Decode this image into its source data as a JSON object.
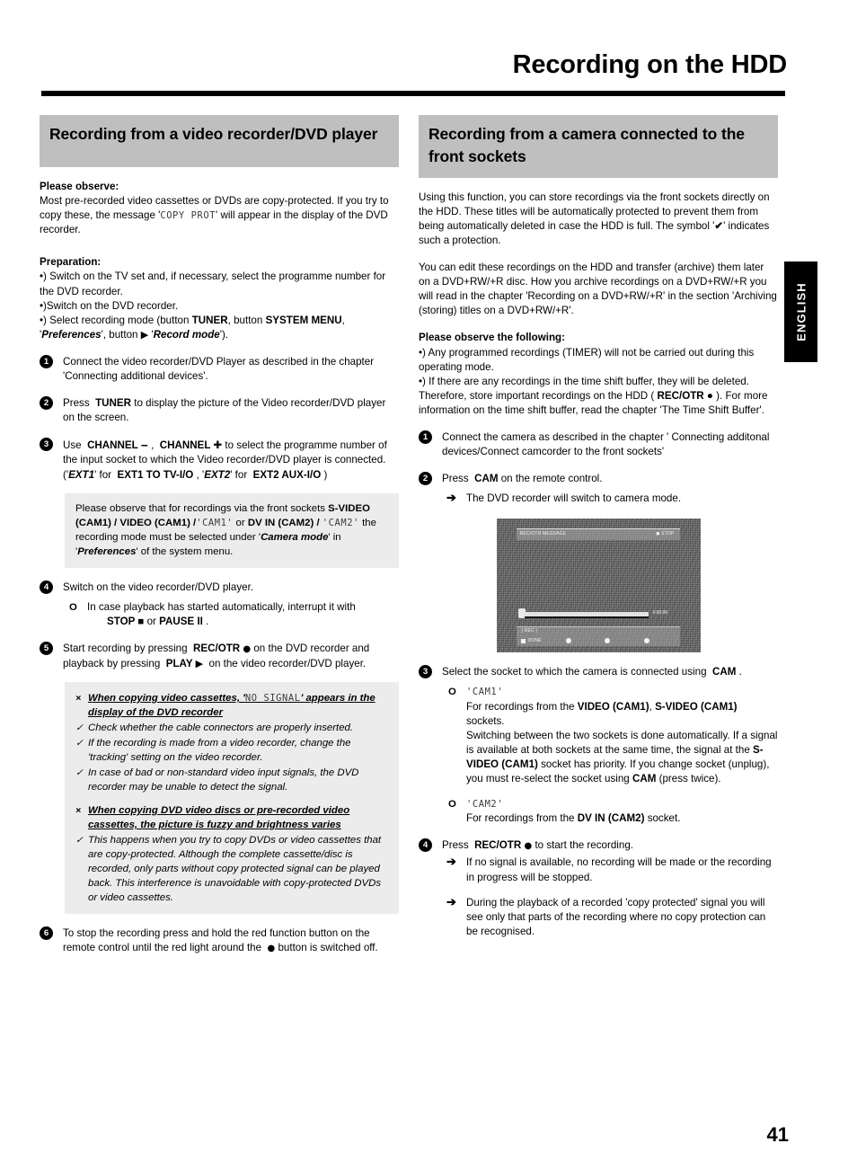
{
  "header": {
    "title": "Recording on the HDD"
  },
  "lang_tab": {
    "label": "ENGLISH"
  },
  "page_number": "41",
  "left_column": {
    "section_heading": "Recording from a video recorder/DVD player",
    "observe_heading": "Please observe:",
    "observe_text_1": "Most pre-recorded video cassettes or DVDs are copy-protected. If you try to copy these, the message '",
    "observe_lcd": "COPY PROT",
    "observe_text_2": "' will appear in the display of the DVD recorder.",
    "preparation_heading": "Preparation:",
    "prep_1": "•) Switch on the TV set and, if necessary, select the programme number for the DVD recorder.",
    "prep_2": "•)Switch on the DVD recorder.",
    "prep_3_a": "•) Select recording mode (button",
    "prep_3_b": "TUNER",
    "prep_3_c": ", button",
    "prep_3_d": "SYSTEM MENU",
    "prep_3_e": ", '",
    "prep_3_f": "Preferences",
    "prep_3_g": "', button",
    "prep_3_h": "'",
    "prep_3_i": "Record mode",
    "prep_3_j": "').",
    "steps": [
      {
        "num": "1",
        "text": "Connect the video recorder/DVD Player as described in the chapter 'Connecting additional devices'."
      },
      {
        "num": "2",
        "text": "Press  TUNER  to display the picture of the Video recorder/DVD player on the screen."
      },
      {
        "num": "3",
        "text": "Use  CHANNEL −  ,  CHANNEL +  to select the programme number of the input socket to which the Video recorder/DVD player is connected. ('EXT1' for  EXT1 TO TV-I/O , 'EXT2' for  EXT2 AUX-I/O )"
      },
      {
        "num": "4",
        "text": "Switch on the video recorder/DVD player."
      },
      {
        "num": "5",
        "text": "Start recording by pressing  REC/OTR ●  on the DVD recorder and playback by pressing  PLAY ▶  on the video recorder/DVD player."
      },
      {
        "num": "6",
        "text": "To stop the recording press and hold the red function button on the remote control until the red light around the ● button is switched off."
      }
    ],
    "step3_note": {
      "t1": "Please observe that for recordings via the front sockets",
      "b1": "S-VIDEO (CAM1)",
      "s1": "/",
      "b2": "VIDEO (CAM1)",
      "s2": "/",
      "lcd1": "CAM1",
      "t2": "or",
      "b3": "DV IN (CAM2)",
      "s3": "/",
      "lcd2": "CAM2",
      "t3": "the recording mode must be selected under '",
      "bi1": "Camera mode",
      "t4": "' in '",
      "bi2": "Preferences",
      "t5": "' of the system menu."
    },
    "step4_sub": {
      "t1": "In case playback has started automatically, interrupt it with",
      "b1": "STOP ■",
      "t2": "or",
      "b2": "PAUSE II",
      "t3": "."
    },
    "trouble_1": {
      "problem_a": "When copying video cassettes, '",
      "problem_lcd": "NO SIGNAL",
      "problem_b": "' appears in the display of the DVD recorder",
      "solutions": [
        "Check whether the cable connectors are properly inserted.",
        "If the recording is made from a video recorder, change the 'tracking' setting on the video recorder.",
        "In case of bad or non-standard video input signals, the DVD recorder may be unable to detect the signal."
      ]
    },
    "trouble_2": {
      "problem": "When copying DVD video discs or pre-recorded video cassettes, the picture is fuzzy and brightness varies",
      "solutions": [
        "This happens when you try to copy DVDs or video cassettes that are copy-protected. Although the complete cassette/disc is recorded, only parts without copy protected signal can be played back. This interference is unavoidable with copy-protected DVDs or video cassettes."
      ]
    }
  },
  "right_column": {
    "section_heading": "Recording from a camera connected to the front sockets",
    "intro_1_a": "Using this function, you can store recordings via the front sockets directly on the HDD. These titles will be automatically protected to prevent them from being automatically deleted in case the HDD is full. The symbol '",
    "intro_1_check": "✔",
    "intro_1_b": "' indicates such a protection.",
    "intro_2": "You can edit these recordings on the HDD and transfer (archive) them later on a DVD+RW/+R disc. How you archive recordings on a DVD+RW/+R you will read in the chapter 'Recording on a DVD+RW/+R' in the section 'Archiving (storing) titles on a DVD+RW/+R'.",
    "observe_heading": "Please observe the following:",
    "observe_1": "•) Any programmed recordings (TIMER) will not be carried out during this operating mode.",
    "observe_2_a": "•) If there are any recordings in the time shift buffer, they will be deleted. Therefore, store important recordings on the HDD (",
    "observe_2_b": "REC/OTR ●",
    "observe_2_c": "). For more information on the time shift buffer, read the chapter 'The Time Shift Buffer'.",
    "steps": [
      {
        "num": "1",
        "text": "Connect the camera as described in the chapter ' Connecting additonal devices/Connect camcorder to the front sockets'"
      },
      {
        "num": "2",
        "text": "Press  CAM  on the remote control."
      },
      {
        "num": "3",
        "text": "Select the socket to which the camera is connected using  CAM ."
      },
      {
        "num": "4",
        "text": "Press  REC/OTR ●  to start the recording."
      }
    ],
    "step2_sub": "The DVD recorder will switch to camera mode.",
    "screenshot": {
      "osd_top_left": "REC/OTR MESSAGE",
      "osd_top_right": "◼ STOP",
      "osd_time": "0:00:00",
      "osd_rec_label": "[ REC ]",
      "osd_done_label": "DONE"
    },
    "cam1_block": {
      "lcd": "CAM1",
      "l1_a": "For recordings from the",
      "l1_b": "VIDEO (CAM1)",
      "l1_c": ",",
      "l1_d": "S-VIDEO (CAM1)",
      "l1_e": "sockets.",
      "l2_a": "Switching between the two sockets is done automatically. If a signal is available at both sockets at the same time, the signal at the",
      "l2_b": "S-VIDEO (CAM1)",
      "l2_c": "socket has priority. If you change socket (unplug), you must re-select the socket using",
      "l2_d": "CAM",
      "l2_e": "(press twice)."
    },
    "cam2_block": {
      "lcd": "CAM2",
      "l1_a": "For recordings from the",
      "l1_b": "DV IN (CAM2)",
      "l1_c": "socket."
    },
    "step4_subs": [
      "If no signal is available, no recording will be made or the recording in progress will be stopped.",
      "During the playback of a recorded 'copy protected' signal you will see only that parts of the recording where no copy protection can be recognised."
    ]
  },
  "colors": {
    "heading_band": "#bfbfbf",
    "note_box": "#ececec",
    "rule": "#000000"
  }
}
